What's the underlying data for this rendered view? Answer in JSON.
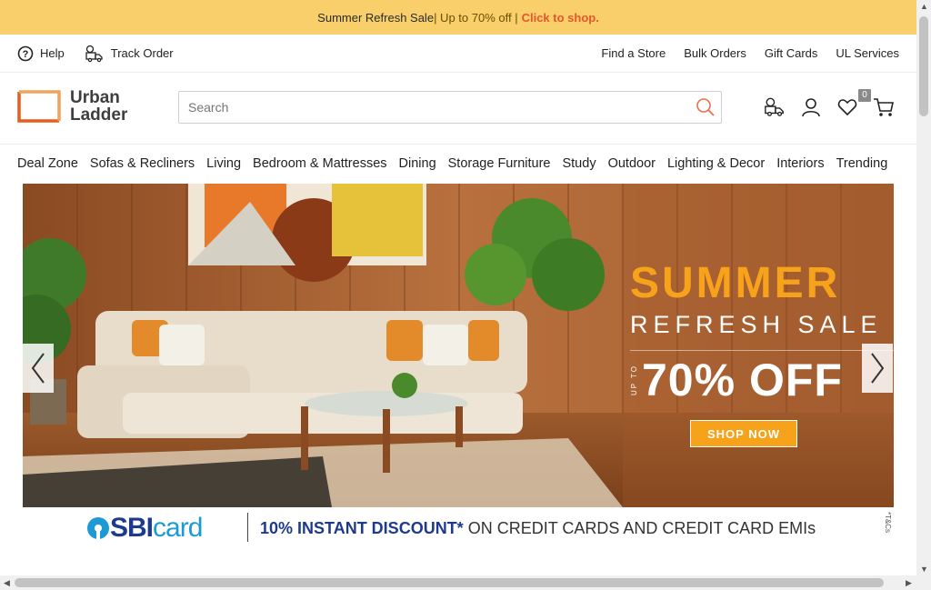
{
  "promo": {
    "text": "Summer Refresh Sale",
    "sep": "| Up to 70% off |",
    "cta": "Click to shop."
  },
  "util": {
    "help": "Help",
    "track": "Track Order",
    "links": [
      "Find a Store",
      "Bulk Orders",
      "Gift Cards",
      "UL Services"
    ]
  },
  "logo": {
    "line1": "Urban",
    "line2": "Ladder"
  },
  "search": {
    "placeholder": "Search"
  },
  "cart": {
    "wishlist_count": "0"
  },
  "nav": [
    "Deal Zone",
    "Sofas & Recliners",
    "Living",
    "Bedroom & Mattresses",
    "Dining",
    "Storage Furniture",
    "Study",
    "Outdoor",
    "Lighting & Decor",
    "Interiors",
    "Trending"
  ],
  "hero": {
    "line1": "SUMMER",
    "line2": "REFRESH SALE",
    "upto": "UP TO",
    "line3": "70% OFF",
    "button": "SHOP NOW"
  },
  "strip": {
    "brand1": "SBI",
    "brand2": "card",
    "offer_bold": "10% INSTANT DISCOUNT*",
    "offer_rest": " ON CREDIT CARDS AND CREDIT CARD EMIs",
    "tnc": "*T&Cs"
  },
  "colors": {
    "promo_bg": "#f8cf6a",
    "accent": "#f7a21b",
    "cta": "#e4572e",
    "sbi_blue": "#1d3a8f"
  }
}
